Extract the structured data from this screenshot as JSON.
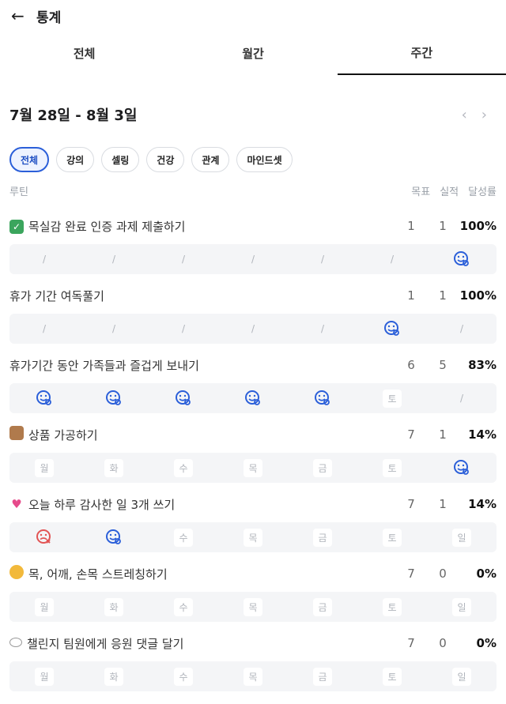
{
  "header": {
    "back_icon": "←",
    "title": "통계"
  },
  "tabs": [
    "전체",
    "월간",
    "주간"
  ],
  "active_tab": 2,
  "date_range": "7월 28일 - 8월 3일",
  "nav": {
    "prev": "‹",
    "next": "›"
  },
  "filters": [
    "전체",
    "강의",
    "셀링",
    "건강",
    "관계",
    "마인드셋"
  ],
  "active_filter": 0,
  "columns": {
    "routine": "루틴",
    "goal": "목표",
    "actual": "실적",
    "rate": "달성률"
  },
  "weekday_labels": [
    "월",
    "화",
    "수",
    "목",
    "금",
    "토",
    "일"
  ],
  "routines": [
    {
      "icon": "check-box-icon",
      "name": "목실감 완료 인증 과제 제출하기",
      "goal": "1",
      "actual": "1",
      "rate": "100%",
      "days": [
        "/",
        "/",
        "/",
        "/",
        "/",
        "/",
        "success"
      ]
    },
    {
      "icon": "",
      "name": "휴가 기간 여독풀기",
      "goal": "1",
      "actual": "1",
      "rate": "100%",
      "days": [
        "/",
        "/",
        "/",
        "/",
        "/",
        "success",
        "/"
      ]
    },
    {
      "icon": "",
      "name": "휴가기간 동안 가족들과 즐겁게 보내기",
      "goal": "6",
      "actual": "5",
      "rate": "83%",
      "days": [
        "success",
        "success",
        "success",
        "success",
        "success",
        "토",
        "/"
      ]
    },
    {
      "icon": "package-icon",
      "name": "상품 가공하기",
      "goal": "7",
      "actual": "1",
      "rate": "14%",
      "days": [
        "월",
        "화",
        "수",
        "목",
        "금",
        "토",
        "success"
      ]
    },
    {
      "icon": "heart-icon",
      "name": "오늘 하루 감사한 일 3개 쓰기",
      "goal": "7",
      "actual": "1",
      "rate": "14%",
      "days": [
        "fail",
        "success",
        "수",
        "목",
        "금",
        "토",
        "일"
      ]
    },
    {
      "icon": "muscle-icon",
      "name": "목, 어깨, 손목 스트레칭하기",
      "goal": "7",
      "actual": "0",
      "rate": "0%",
      "days": [
        "월",
        "화",
        "수",
        "목",
        "금",
        "토",
        "일"
      ]
    },
    {
      "icon": "speech-bubble-icon",
      "name": "챌린지 팀원에게 응원 댓글 달기",
      "goal": "7",
      "actual": "0",
      "rate": "0%",
      "days": [
        "월",
        "화",
        "수",
        "목",
        "금",
        "토",
        "일"
      ]
    }
  ],
  "colors": {
    "accent": "#2b5fd9",
    "fail": "#e25454",
    "muted": "#b0b4bb"
  }
}
